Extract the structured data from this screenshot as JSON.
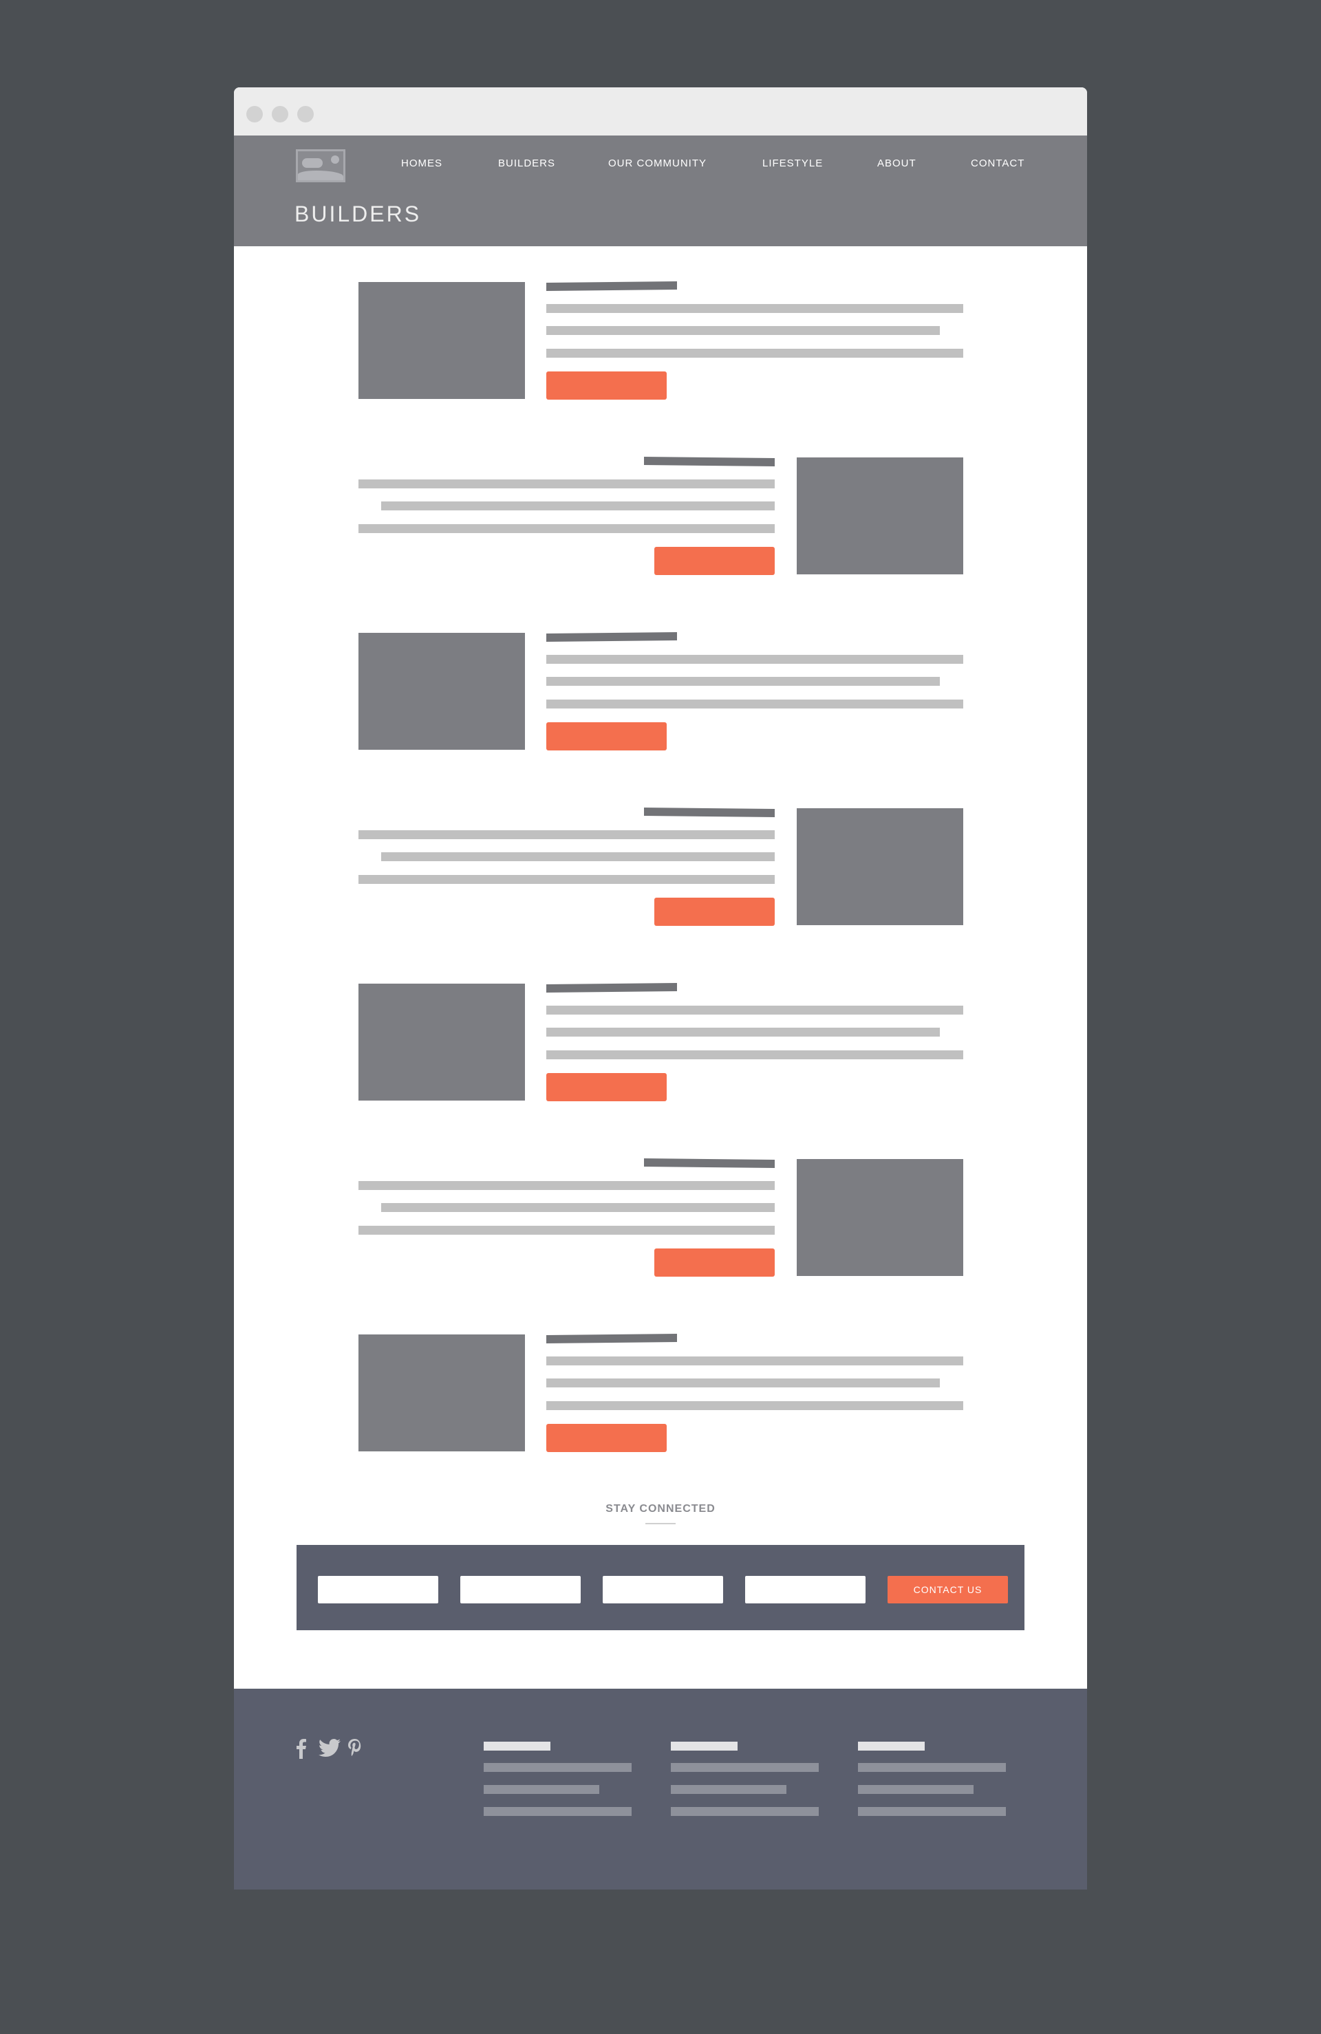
{
  "nav": {
    "items": [
      "HOMES",
      "BUILDERS",
      "OUR COMMUNITY",
      "LIFESTYLE",
      "ABOUT",
      "CONTACT"
    ]
  },
  "page": {
    "title": "BUILDERS"
  },
  "stay_connected": {
    "heading": "STAY CONNECTED",
    "button_label": "CONTACT US"
  },
  "footer": {
    "social_icons": [
      "facebook-icon",
      "twitter-icon",
      "pinterest-icon"
    ]
  },
  "colors": {
    "accent": "#f46f4e",
    "header": "#7c7d82",
    "footer": "#5a5e6d",
    "background": "#4b4f53"
  }
}
